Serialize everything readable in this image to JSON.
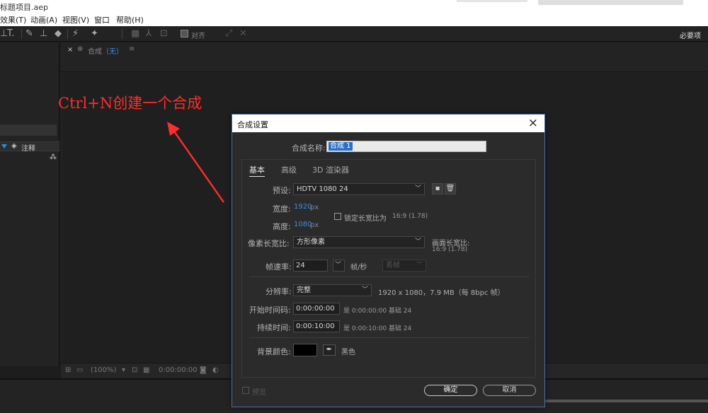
{
  "window": {
    "title": "标题项目.aep"
  },
  "menu": {
    "effects": "效果(T)",
    "animation": "动画(A)",
    "view": "视图(V)",
    "window": "窗口",
    "help": "帮助(H)"
  },
  "toolbar": {
    "text_tool": "T.",
    "align_label": "对齐",
    "workspace": "必要项"
  },
  "left_panel": {
    "comment_label": "注释"
  },
  "comp_panel": {
    "tab_title": "合成",
    "tab_none": "（无）",
    "zoom": "(100%)",
    "timecode": "0:00:00:00"
  },
  "annotation": {
    "text": "Ctrl+N创建一个合成",
    "color": "#ff2d2d"
  },
  "dialog": {
    "title": "合成设置",
    "close_icon": "×",
    "name_label": "合成名称:",
    "name_value": "合成 1",
    "tabs": [
      "基本",
      "高级",
      "3D 渲染器"
    ],
    "preset_label": "预设:",
    "preset_value": "HDTV 1080 24",
    "width_label": "宽度:",
    "width_value": "1920",
    "height_label": "高度:",
    "height_value": "1080",
    "unit_px": "px",
    "lock_aspect_label": "锁定长宽比为",
    "lock_aspect_value": "16:9 (1.78)",
    "pixel_aspect_label": "像素长宽比:",
    "pixel_aspect_value": "方形像素",
    "frame_aspect_label": "画面长宽比:",
    "frame_aspect_value": "16:9 (1.78)",
    "frame_rate_label": "帧速率:",
    "frame_rate_value": "24",
    "fps_unit": "帧/秒",
    "frame_rate_mode": "丢帧",
    "resolution_label": "分辨率:",
    "resolution_value": "完整",
    "resolution_info": "1920 x 1080，7.9 MB（每 8bpc 帧）",
    "start_tc_label": "开始时间码:",
    "start_tc_value": "0:00:00:00",
    "start_tc_info": "是 0:00:00:00  基础 24",
    "duration_label": "持续时间:",
    "duration_value": "0:00:10:00",
    "duration_info": "是 0:00:10:00  基础 24",
    "bg_color_label": "背景颜色:",
    "bg_color_value": "#000000",
    "bg_color_name": "黑色",
    "preview_label": "预览",
    "ok_label": "确定",
    "cancel_label": "取消"
  }
}
